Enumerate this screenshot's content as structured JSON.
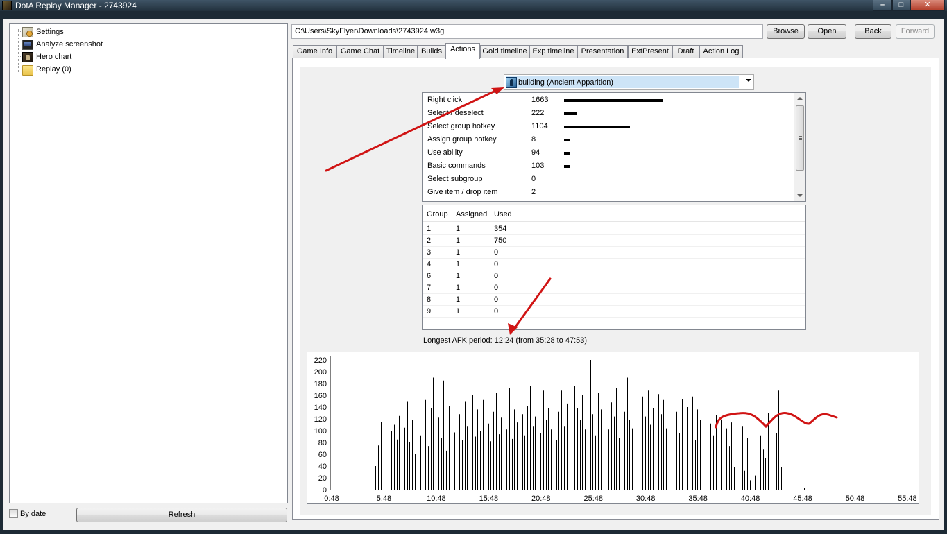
{
  "window": {
    "title": "DotA Replay Manager - 2743924"
  },
  "sidebar": {
    "items": [
      {
        "label": "Settings",
        "icon": "settings-icon"
      },
      {
        "label": "Analyze screenshot",
        "icon": "screenshot-icon"
      },
      {
        "label": "Hero chart",
        "icon": "hero-chart-icon"
      },
      {
        "label": "Replay (0)",
        "icon": "folder-icon"
      }
    ],
    "by_date_label": "By date",
    "by_date_checked": false,
    "refresh_label": "Refresh"
  },
  "toolbar": {
    "path_value": "C:\\Users\\SkyFlyer\\Downloads\\2743924.w3g",
    "browse_label": "Browse",
    "open_label": "Open",
    "back_label": "Back",
    "forward_label": "Forward"
  },
  "tabs": [
    {
      "label": "Game Info"
    },
    {
      "label": "Game Chat"
    },
    {
      "label": "Timeline"
    },
    {
      "label": "Builds"
    },
    {
      "label": "Actions",
      "active": true
    },
    {
      "label": "Gold timeline"
    },
    {
      "label": "Exp timeline"
    },
    {
      "label": "Presentation"
    },
    {
      "label": "ExtPresent"
    },
    {
      "label": "Draft"
    },
    {
      "label": "Action Log"
    }
  ],
  "actions": {
    "player_select": "building (Ancient Apparition)",
    "rows": [
      {
        "name": "Right click",
        "value": 1663
      },
      {
        "name": "Select / deselect",
        "value": 222
      },
      {
        "name": "Select group hotkey",
        "value": 1104
      },
      {
        "name": "Assign group hotkey",
        "value": 8
      },
      {
        "name": "Use ability",
        "value": 94
      },
      {
        "name": "Basic commands",
        "value": 103
      },
      {
        "name": "Select subgroup",
        "value": 0
      },
      {
        "name": "Give item / drop item",
        "value": 2
      }
    ],
    "groups": {
      "headers": [
        "Group",
        "Assigned",
        "Used"
      ],
      "rows": [
        [
          "1",
          "1",
          "354"
        ],
        [
          "2",
          "1",
          "750"
        ],
        [
          "3",
          "1",
          "0"
        ],
        [
          "4",
          "1",
          "0"
        ],
        [
          "6",
          "1",
          "0"
        ],
        [
          "7",
          "1",
          "0"
        ],
        [
          "8",
          "1",
          "0"
        ],
        [
          "9",
          "1",
          "0"
        ]
      ]
    },
    "afk_text": "Longest AFK period: 12:24 (from 35:28 to 47:53)"
  },
  "chart_data": {
    "type": "bar",
    "ylim": [
      0,
      220
    ],
    "yticks": [
      0,
      20,
      40,
      60,
      80,
      100,
      120,
      140,
      160,
      180,
      200,
      220
    ],
    "xticks": [
      "0:48",
      "5:48",
      "10:48",
      "15:48",
      "20:48",
      "25:48",
      "30:48",
      "35:48",
      "40:48",
      "45:48",
      "50:48",
      "55:48"
    ],
    "xlim_minutes": [
      0.8,
      56.8
    ],
    "bar_interval_minutes": 0.25,
    "series": [
      {
        "start_minute": 2.05,
        "values": [
          12,
          0,
          60,
          0,
          0,
          0,
          0,
          0,
          22,
          0,
          0,
          0,
          0,
          0,
          0,
          0,
          0,
          0,
          0,
          12,
          0,
          0,
          0,
          0,
          0,
          0,
          0,
          0,
          0,
          0,
          0,
          0,
          0,
          0,
          0,
          0,
          0,
          0,
          0,
          0,
          0,
          0,
          0,
          0,
          0,
          0,
          0,
          0,
          0,
          0,
          0,
          0,
          0,
          0,
          0,
          0,
          0,
          0,
          0,
          0,
          0,
          0,
          0,
          0,
          0,
          0,
          0,
          0,
          0,
          0,
          0,
          0,
          0,
          0,
          0,
          0,
          0,
          0,
          0,
          0,
          0,
          0,
          0,
          0,
          0,
          0,
          0,
          0,
          0,
          0,
          0,
          0,
          0,
          0,
          0,
          0,
          0,
          0,
          0,
          0,
          0,
          0,
          0,
          0,
          0,
          0,
          0,
          0,
          0,
          0,
          0,
          0,
          0,
          0,
          0,
          0,
          0,
          0,
          0,
          0,
          0,
          0,
          0,
          0,
          0,
          0,
          0,
          0,
          0,
          0,
          0,
          0,
          0,
          0,
          0,
          0,
          0,
          0,
          0,
          0
        ]
      },
      {
        "start_minute": 5.0,
        "values": [
          40,
          75,
          115,
          95,
          120,
          70,
          100,
          110,
          85,
          125,
          90,
          105,
          150,
          80,
          118,
          60,
          128,
          92,
          112,
          152,
          74,
          138,
          190,
          102,
          122,
          88,
          185,
          66,
          142,
          118,
          97,
          172,
          128,
          84,
          150,
          108,
          118,
          160,
          90,
          136,
          100,
          152,
          186,
          112,
          82,
          132,
          164,
          94,
          122,
          146,
          102,
          172,
          86,
          136,
          114,
          156,
          128,
          92,
          142,
          176,
          108,
          124,
          152,
          96,
          168,
          118,
          138,
          102,
          160,
          84,
          132,
          168,
          108,
          146,
          122,
          94,
          176,
          138,
          118,
          160,
          102,
          148,
          220,
          128,
          92,
          164,
          136,
          112,
          182,
          102,
          148,
          124,
          172,
          88,
          158,
          132,
          190,
          118,
          104,
          168,
          142,
          92,
          158,
          124,
          168,
          110,
          138,
          96,
          162,
          128,
          152,
          104,
          142,
          176,
          114,
          132,
          96,
          154,
          124,
          140,
          106,
          158,
          84,
          136,
          118,
          130,
          76,
          144,
          112,
          92,
          126,
          62,
          118,
          88,
          104,
          74,
          114,
          38,
          96,
          56,
          108,
          32,
          88,
          16,
          46,
          24,
          112,
          92,
          68,
          54,
          130,
          74,
          162,
          96,
          168,
          38
        ]
      },
      {
        "start_minute": 45.9,
        "values": [
          3,
          0,
          0,
          0,
          0,
          4
        ]
      }
    ]
  }
}
